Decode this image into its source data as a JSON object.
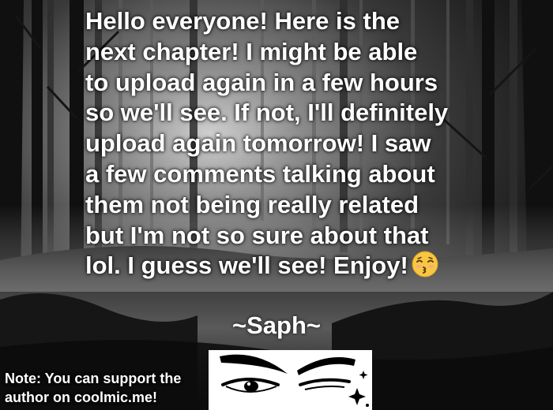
{
  "message": {
    "lines": [
      "Hello everyone! Here is the",
      "next chapter! I might be able",
      "to upload again in a few hours",
      "so we'll see. If not, I'll definitely",
      "upload again tomorrow! I saw",
      "a few comments talking about",
      "them not being really related",
      "but I'm not so sure about that",
      "lol. I guess we'll see! Enjoy!"
    ],
    "emoji": "kissing-face-closed-eyes-icon"
  },
  "signature": "~Saph~",
  "note": {
    "line1": "Note: You can support the",
    "line2": "author on coolmic.me!"
  },
  "image": {
    "type": "eyes-sketch-icon"
  },
  "colors": {
    "text": "#ffffff",
    "background": "#000000",
    "emoji": "#f7c744"
  }
}
